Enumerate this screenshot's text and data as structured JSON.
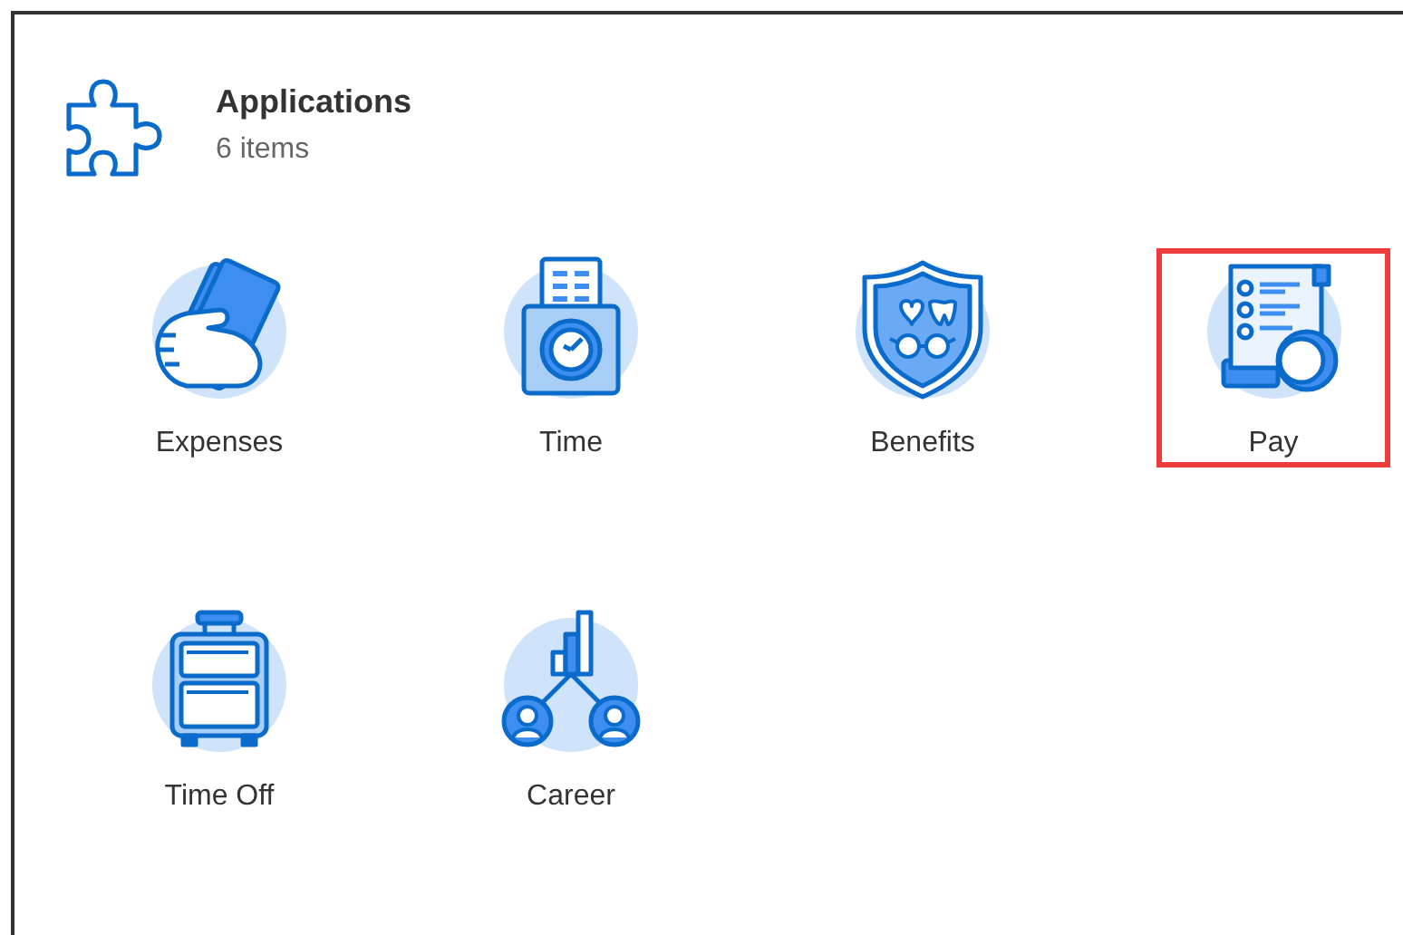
{
  "header": {
    "title": "Applications",
    "count": "6 items"
  },
  "apps": [
    {
      "label": "Expenses",
      "highlighted": false
    },
    {
      "label": "Time",
      "highlighted": false
    },
    {
      "label": "Benefits",
      "highlighted": false
    },
    {
      "label": "Pay",
      "highlighted": true
    },
    {
      "label": "Time Off",
      "highlighted": false
    },
    {
      "label": "Career",
      "highlighted": false
    }
  ]
}
